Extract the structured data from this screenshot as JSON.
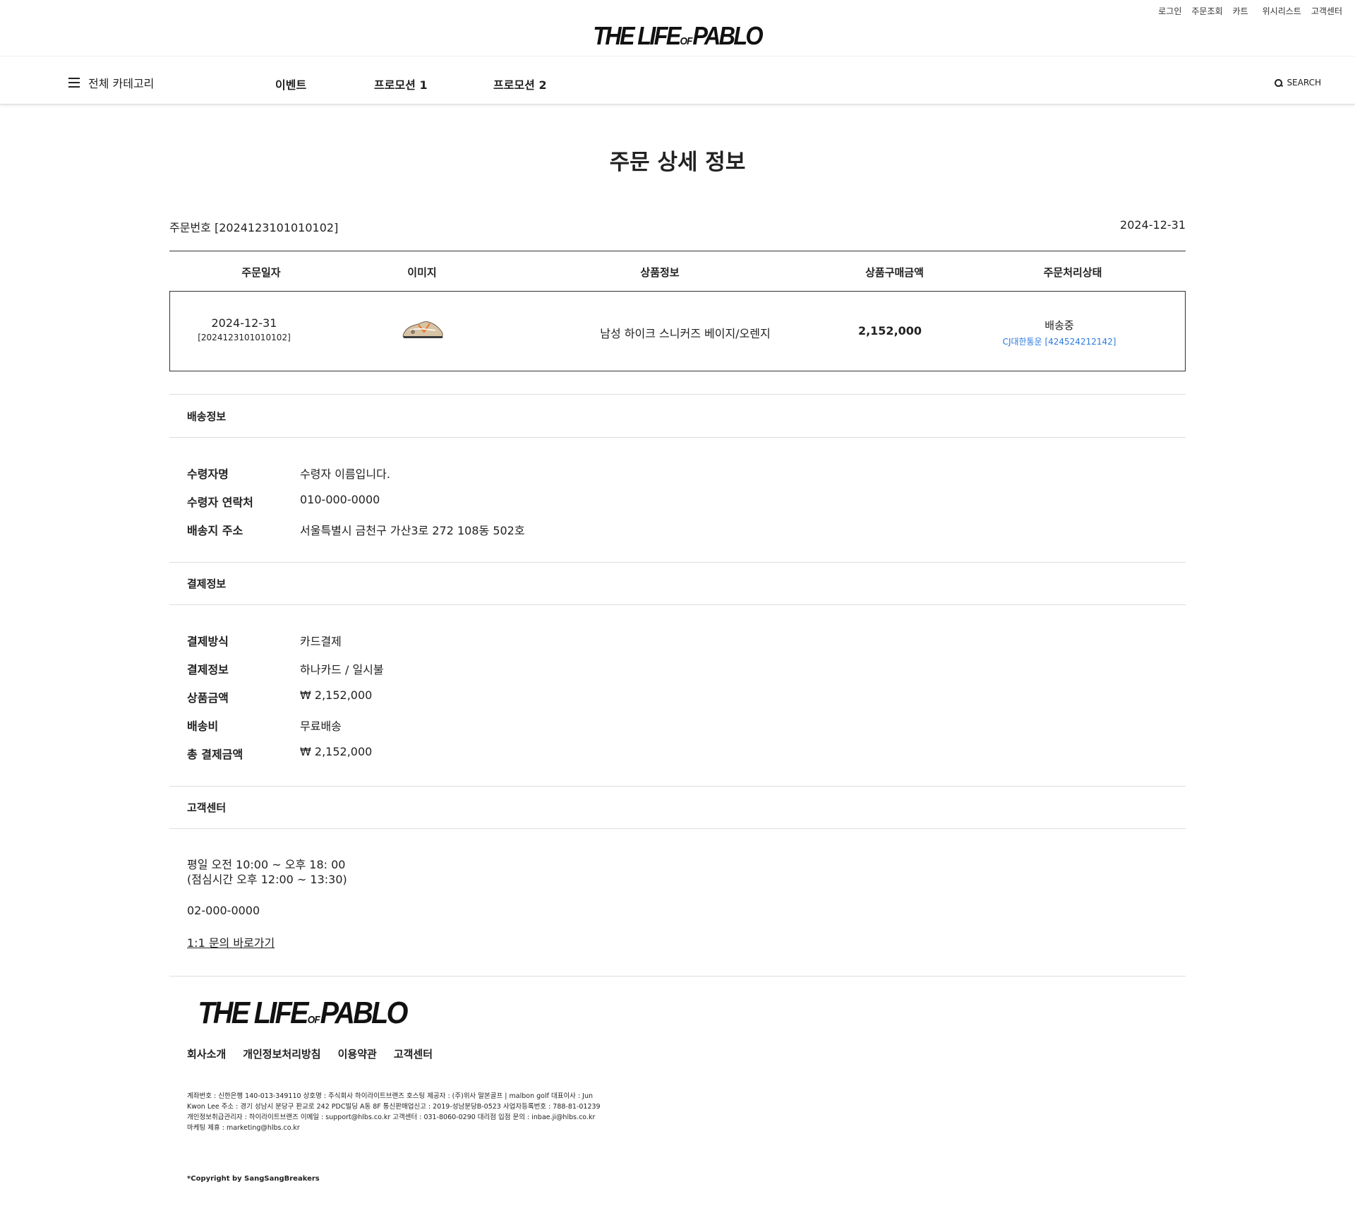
{
  "util_menu": [
    "로그인",
    "주문조회",
    "카트",
    "위시리스트",
    "고객센터"
  ],
  "logo": {
    "main": "THE LIFE",
    "of": "OF",
    "end": "PABLO"
  },
  "nav": {
    "category": "전체 카테고리",
    "links": [
      "이벤트",
      "프로모션 1",
      "프로모션 2"
    ],
    "search": "SEARCH"
  },
  "page_title": "주문 상세 정보",
  "order": {
    "number_label": "주문번호 [2024123101010102]",
    "date": "2024-12-31"
  },
  "table": {
    "headers": [
      "주문일자",
      "이미지",
      "상품정보",
      "상품구매금액",
      "주문처리상태"
    ],
    "row": {
      "date": "2024-12-31",
      "order_no": "[2024123101010102]",
      "product": "남성 하이크 스니커즈 베이지/오렌지",
      "price": "2,152,000",
      "status": "배송중",
      "tracking": "CJ대한통운 [424524212142]"
    }
  },
  "shipping": {
    "title": "배송정보",
    "rows": [
      {
        "label": "수령자명",
        "value": "수령자 이름입니다."
      },
      {
        "label": "수령자 연락처",
        "value": "010-000-0000"
      },
      {
        "label": "배송지 주소",
        "value": "서울특별시 금천구 가산3로 272 108동 502호"
      }
    ]
  },
  "payment": {
    "title": "결제정보",
    "rows": [
      {
        "label": "결제방식",
        "value": "카드결제"
      },
      {
        "label": "결제정보",
        "value": "하나카드 / 일시불"
      },
      {
        "label": "상품금액",
        "value": "₩ 2,152,000"
      },
      {
        "label": "배송비",
        "value": "무료배송"
      },
      {
        "label": "총 결제금액",
        "value": "₩ 2,152,000"
      }
    ]
  },
  "customer_center": {
    "title": "고객센터",
    "hours1": "평일 오전 10:00 ~ 오후 18: 00",
    "hours2": "(점심시간 오후 12:00 ~ 13:30)",
    "phone": "02-000-0000",
    "inquiry_link": "1:1 문의 바로가기"
  },
  "footer": {
    "links": [
      "회사소개",
      "개인정보처리방침",
      "이용약관",
      "고객센터"
    ],
    "info": "계좌번호 : 신한은행 140-013-349110 상호명 : 주식회사 하이라이트브랜즈 호스팅 제공자 : (주)위사 말본골프 | malbon golf 대표이사 : Jun Kwon Lee 주소 : 경기 성남시 분당구 판교로 242 PDC빌딩 A동 8F 통신판매업신고 : 2019-성남분당B-0523 사업자등록번호 : 788-81-01239 개인정보취급관리자 : 하이라이트브랜즈 이메일 : support@hlbs.co.kr 고객센터 : 031-8060-0290 대리점 입점 문의 : inbae.ji@hlbs.co.kr 마케팅 제휴 : marketing@hlbs.co.kr",
    "copyright": "*Copyright by SangSangBreakers"
  }
}
